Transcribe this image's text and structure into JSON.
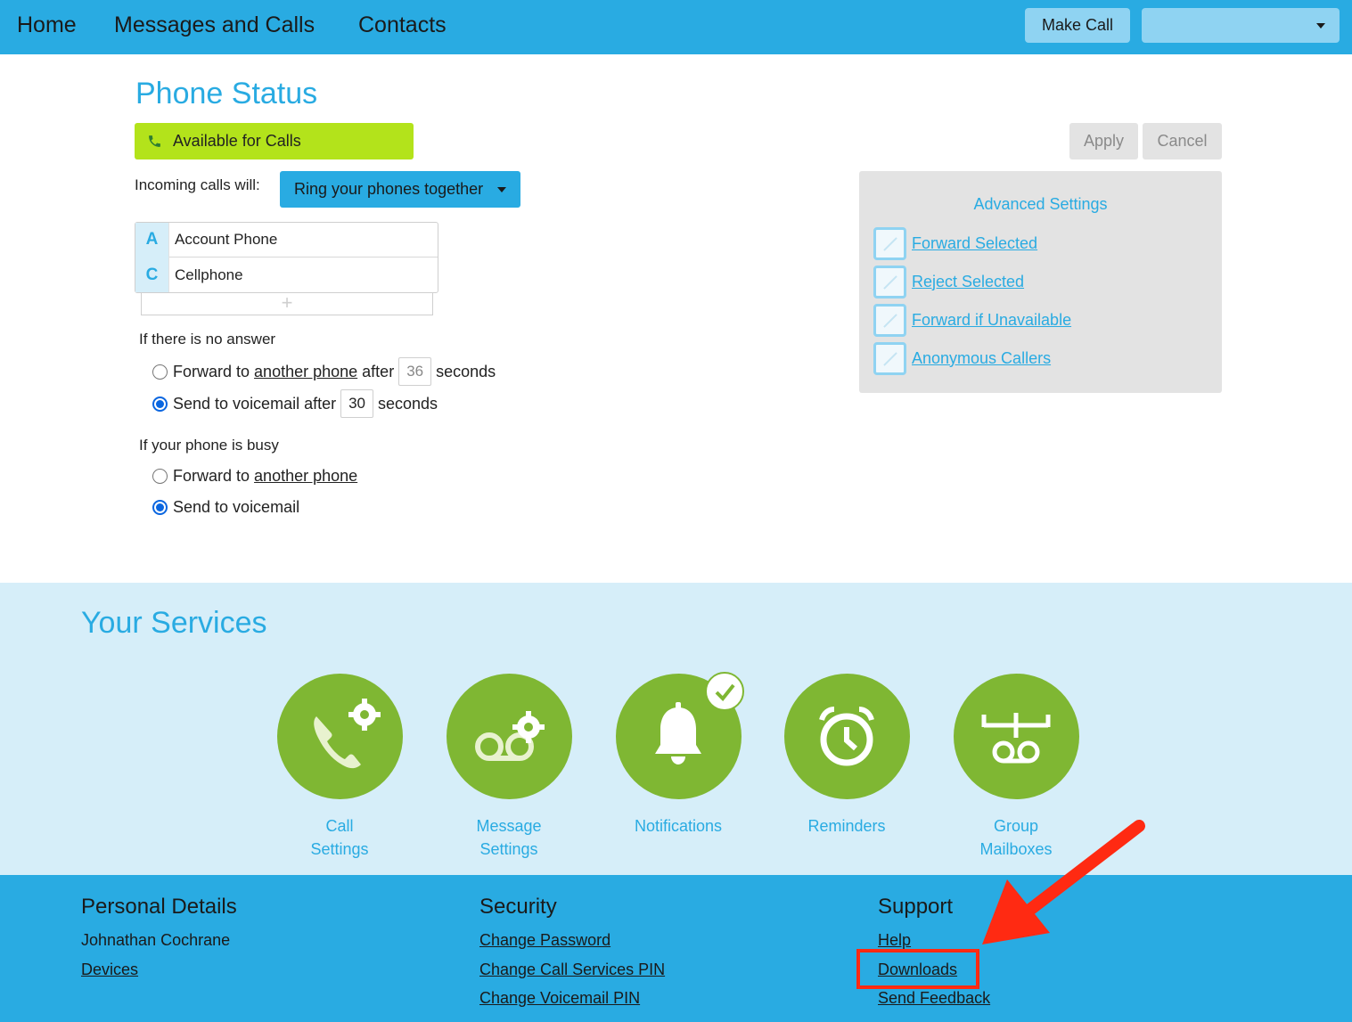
{
  "nav": {
    "home": "Home",
    "messages_calls": "Messages and Calls",
    "contacts": "Contacts",
    "make_call": "Make Call",
    "account_select_value": ""
  },
  "phone_status": {
    "title": "Phone Status",
    "status": "Available for Calls",
    "apply": "Apply",
    "cancel": "Cancel",
    "incoming_label": "Incoming calls will:",
    "ring_mode": "Ring your phones together",
    "phones": [
      {
        "letter": "A",
        "name": "Account Phone"
      },
      {
        "letter": "C",
        "name": "Cellphone"
      }
    ],
    "add_symbol": "+",
    "no_answer": {
      "label": "If there is no answer",
      "forward_prefix": "Forward to",
      "forward_link": "another phone",
      "forward_after": "after",
      "forward_seconds": "36",
      "seconds": "seconds",
      "voicemail_prefix": "Send to voicemail after",
      "voicemail_seconds": "30",
      "selected": "voicemail"
    },
    "busy": {
      "label": "If your phone is busy",
      "forward_prefix": "Forward to",
      "forward_link": "another phone",
      "voicemail": "Send to voicemail",
      "selected": "voicemail"
    }
  },
  "advanced": {
    "title": "Advanced Settings",
    "items": [
      "Forward Selected",
      "Reject Selected",
      "Forward if Unavailable",
      "Anonymous Callers"
    ]
  },
  "services": {
    "title": "Your Services",
    "items": [
      {
        "label": "Call Settings",
        "icon": "phone-gear-icon"
      },
      {
        "label": "Message Settings",
        "icon": "voicemail-gear-icon"
      },
      {
        "label": "Notifications",
        "icon": "bell-icon"
      },
      {
        "label": "Reminders",
        "icon": "alarm-clock-icon"
      },
      {
        "label": "Group Mailboxes",
        "icon": "group-voicemail-icon"
      }
    ]
  },
  "footer": {
    "personal": {
      "heading": "Personal Details",
      "name": "Johnathan Cochrane",
      "devices": "Devices"
    },
    "security": {
      "heading": "Security",
      "links": [
        "Change Password",
        "Change Call Services PIN",
        "Change Voicemail PIN"
      ]
    },
    "support": {
      "heading": "Support",
      "links": [
        "Help",
        "Downloads",
        "Send Feedback"
      ]
    }
  },
  "colors": {
    "brand_blue": "#29abe2",
    "status_green": "#b3e31b",
    "service_green": "#7fb733",
    "annotation_red": "#ff2a12"
  }
}
